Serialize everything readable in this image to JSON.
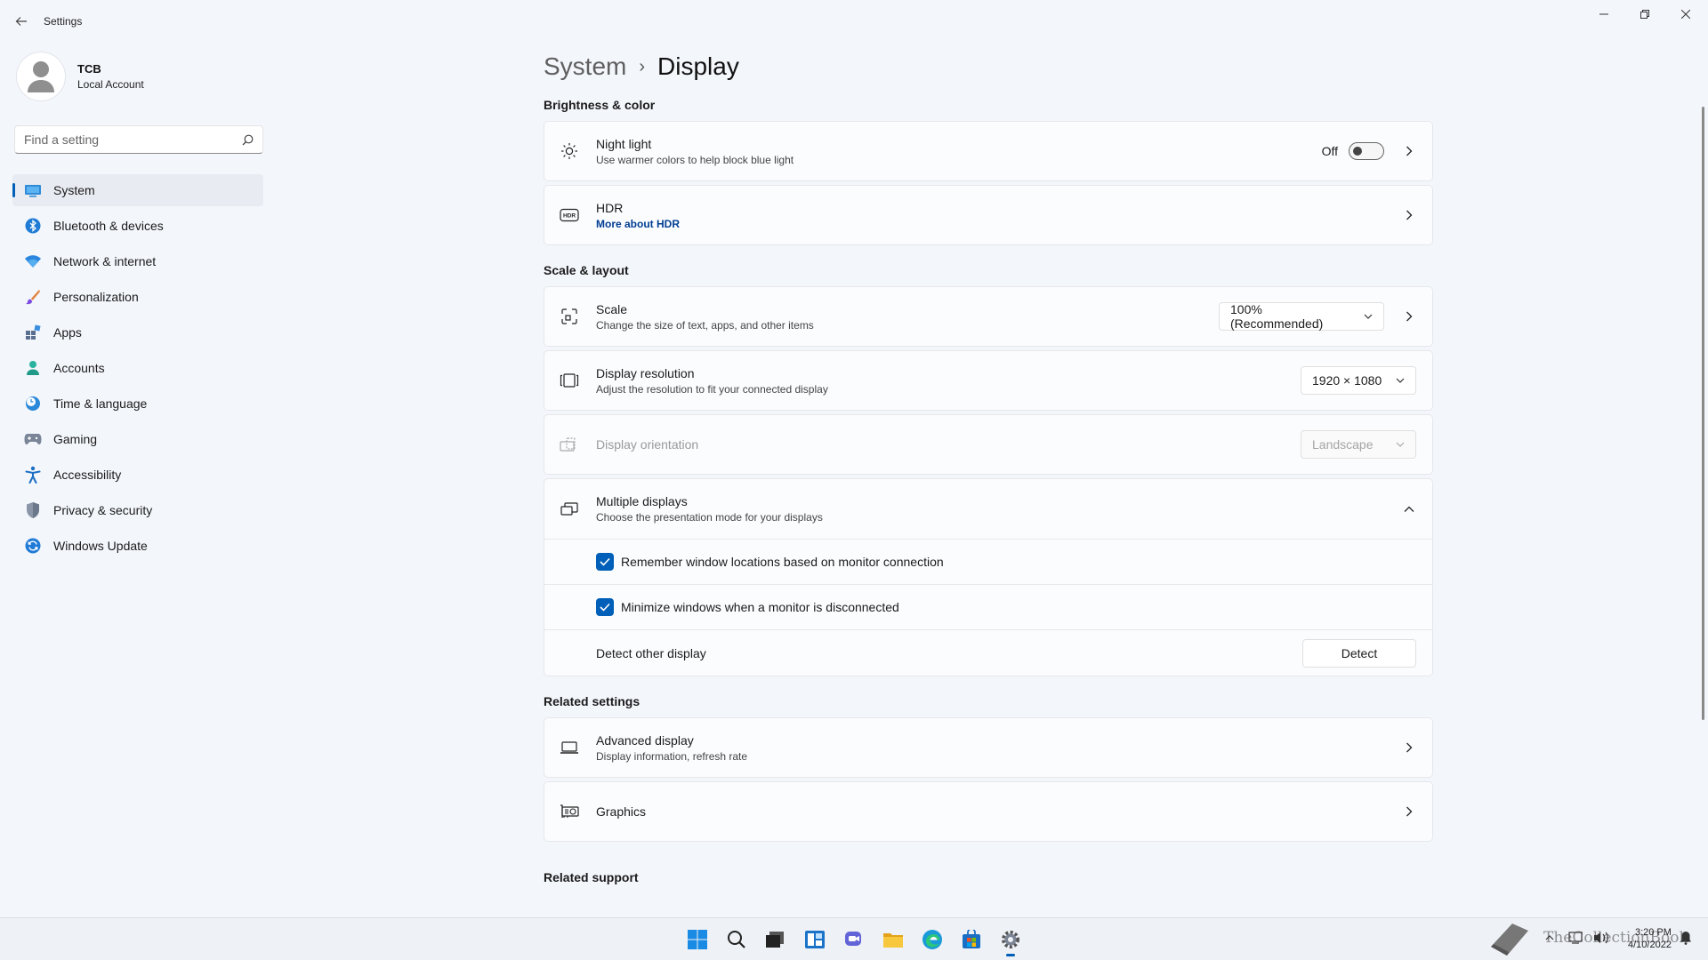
{
  "window": {
    "title": "Settings",
    "controls": {
      "minimize": "—",
      "restore": "❐",
      "close": "✕"
    }
  },
  "profile": {
    "name": "TCB",
    "account": "Local Account"
  },
  "search": {
    "placeholder": "Find a setting"
  },
  "sidebar": {
    "items": [
      {
        "label": "System",
        "icon": "system-icon",
        "active": true
      },
      {
        "label": "Bluetooth & devices",
        "icon": "bluetooth-icon"
      },
      {
        "label": "Network & internet",
        "icon": "wifi-icon"
      },
      {
        "label": "Personalization",
        "icon": "brush-icon"
      },
      {
        "label": "Apps",
        "icon": "apps-icon"
      },
      {
        "label": "Accounts",
        "icon": "person-icon"
      },
      {
        "label": "Time & language",
        "icon": "clock-globe-icon"
      },
      {
        "label": "Gaming",
        "icon": "gamepad-icon"
      },
      {
        "label": "Accessibility",
        "icon": "accessibility-icon"
      },
      {
        "label": "Privacy & security",
        "icon": "shield-icon"
      },
      {
        "label": "Windows Update",
        "icon": "update-icon"
      }
    ]
  },
  "breadcrumb": {
    "parent": "System",
    "separator": "›",
    "current": "Display"
  },
  "sections": {
    "brightness": "Brightness & color",
    "scale_layout": "Scale & layout",
    "related_settings": "Related settings",
    "related_support": "Related support"
  },
  "night_light": {
    "title": "Night light",
    "subtitle": "Use warmer colors to help block blue light",
    "state": "Off",
    "on": false
  },
  "hdr": {
    "title": "HDR",
    "link": "More about HDR"
  },
  "scale": {
    "title": "Scale",
    "subtitle": "Change the size of text, apps, and other items",
    "value": "100% (Recommended)"
  },
  "resolution": {
    "title": "Display resolution",
    "subtitle": "Adjust the resolution to fit your connected display",
    "value": "1920 × 1080"
  },
  "orientation": {
    "title": "Display orientation",
    "value": "Landscape",
    "disabled": true
  },
  "multiple_displays": {
    "title": "Multiple displays",
    "subtitle": "Choose the presentation mode for your displays",
    "remember_label": "Remember window locations based on monitor connection",
    "remember_checked": true,
    "minimize_label": "Minimize windows when a monitor is disconnected",
    "minimize_checked": true,
    "detect_label": "Detect other display",
    "detect_button": "Detect"
  },
  "advanced_display": {
    "title": "Advanced display",
    "subtitle": "Display information, refresh rate"
  },
  "graphics": {
    "title": "Graphics"
  },
  "taskbar": {
    "icons": [
      "start-icon",
      "search-icon",
      "task-view-icon",
      "widgets-icon",
      "chat-icon",
      "file-explorer-icon",
      "edge-icon",
      "store-icon",
      "settings-icon"
    ],
    "time": "3:20 PM",
    "date": "4/10/2022",
    "watermark": "TheCollectionBook"
  },
  "colors": {
    "accent": "#005fb8",
    "background": "#f3f6fb",
    "card": "#fbfcfe"
  }
}
